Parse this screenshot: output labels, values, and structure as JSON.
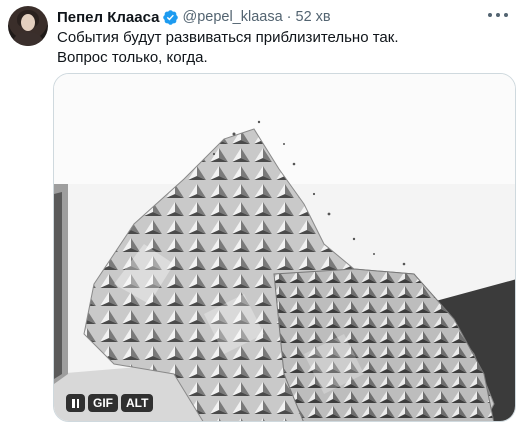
{
  "tweet": {
    "author_name": "Пепел Клааса",
    "handle": "@pepel_klaasa",
    "separator": "·",
    "time": "52 хв",
    "text_lines": [
      "События будут развиваться приблизительно так.",
      "Вопрос только, когда."
    ],
    "verified": true,
    "accent_color": "#1d9bf0"
  },
  "media": {
    "type": "gif",
    "controls": {
      "pause_icon": "pause-icon",
      "gif_label": "GIF",
      "alt_label": "ALT"
    }
  },
  "icons": {
    "more": "more-options-icon",
    "verified": "verified-badge-icon"
  }
}
